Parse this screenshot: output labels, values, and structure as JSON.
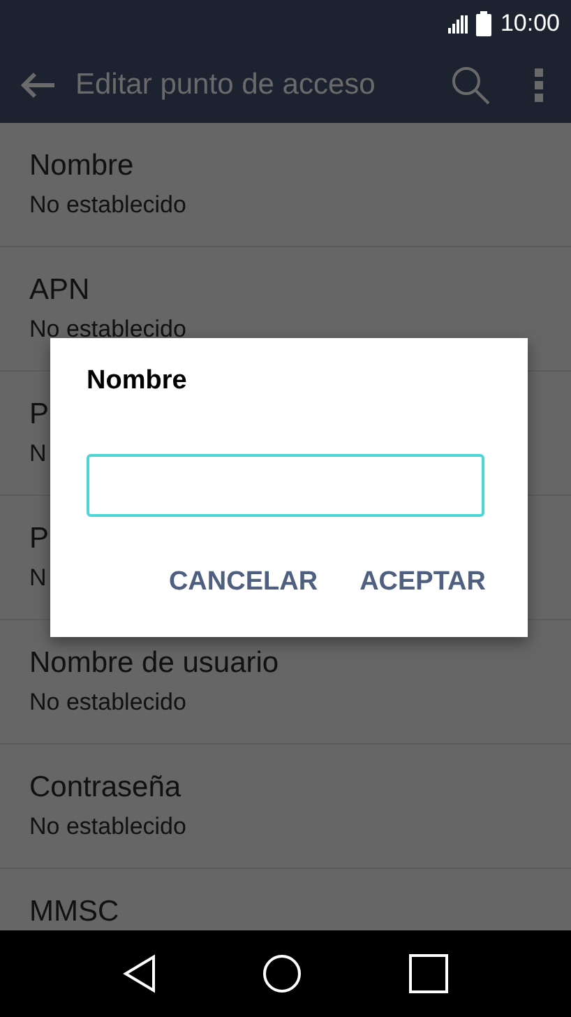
{
  "status_bar": {
    "time": "10:00"
  },
  "app_bar": {
    "title": "Editar punto de acceso"
  },
  "settings": [
    {
      "title": "Nombre",
      "subtitle": "No establecido"
    },
    {
      "title": "APN",
      "subtitle": "No establecido"
    },
    {
      "title": "P",
      "subtitle": "N"
    },
    {
      "title": "P",
      "subtitle": "N"
    },
    {
      "title": "Nombre de usuario",
      "subtitle": "No establecido"
    },
    {
      "title": "Contraseña",
      "subtitle": "No establecido"
    },
    {
      "title": "MMSC"
    }
  ],
  "dialog": {
    "title": "Nombre",
    "field": {
      "focused": true
    },
    "buttons": [
      "CANCELAR",
      "ACEPTAR"
    ]
  }
}
